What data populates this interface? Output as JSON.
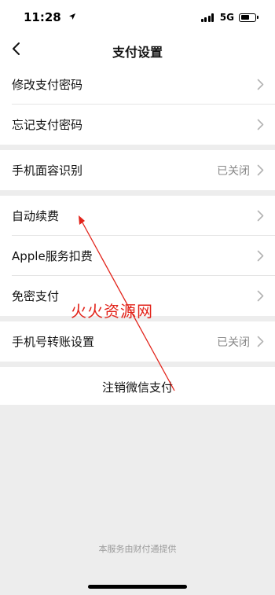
{
  "status_bar": {
    "time": "11:28",
    "network": "5G",
    "battery_level": 0.65
  },
  "header": {
    "title": "支付设置"
  },
  "groups": [
    {
      "rows": [
        {
          "label": "修改支付密码"
        },
        {
          "label": "忘记支付密码"
        }
      ]
    },
    {
      "rows": [
        {
          "label": "手机面容识别",
          "value": "已关闭"
        }
      ]
    },
    {
      "rows": [
        {
          "label": "自动续费"
        },
        {
          "label": "Apple服务扣费"
        },
        {
          "label": "免密支付"
        }
      ]
    },
    {
      "rows": [
        {
          "label": "手机号转账设置",
          "value": "已关闭"
        }
      ]
    }
  ],
  "cancel_action": {
    "label": "注销微信支付"
  },
  "footer": {
    "note": "本服务由财付通提供"
  },
  "watermark": {
    "text": "火火资源网"
  },
  "colors": {
    "annotation": "#e2231a",
    "background": "#ededed",
    "secondary_text": "#888888"
  },
  "icons": {
    "back": "chevron-left-icon",
    "row_arrow": "chevron-right-icon",
    "location": "location-arrow-icon"
  }
}
